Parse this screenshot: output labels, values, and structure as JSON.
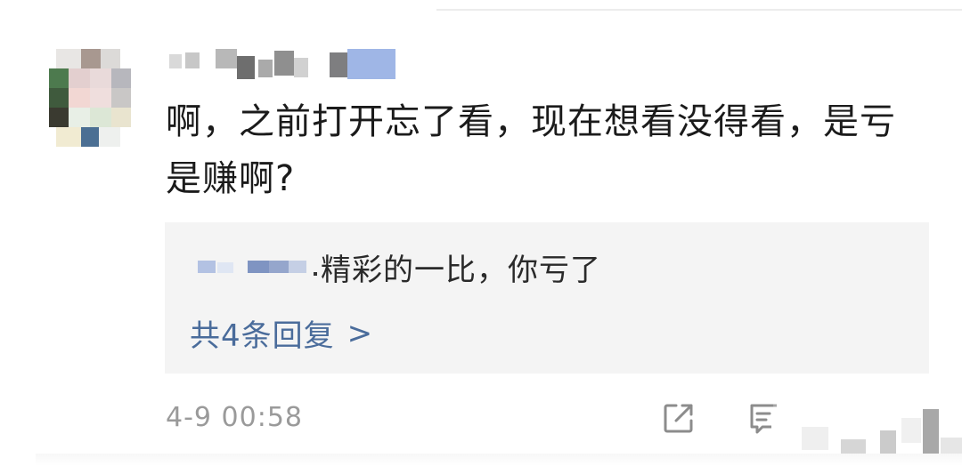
{
  "comment": {
    "text": "啊，之前打开忘了看，现在想看没得看，是亏是赚啊?",
    "timestamp": "4-9 00:58"
  },
  "reply_preview": {
    "text": "精彩的一比，你亏了",
    "separator": ".",
    "count_label": "共4条回复",
    "chevron": ">"
  },
  "icons": {
    "share": "share-icon",
    "comment": "comment-icon"
  },
  "colors": {
    "text": "#1b1b1b",
    "link": "#4a6c9b",
    "muted": "#9a9a9a",
    "reply_bg": "#f4f4f4"
  }
}
